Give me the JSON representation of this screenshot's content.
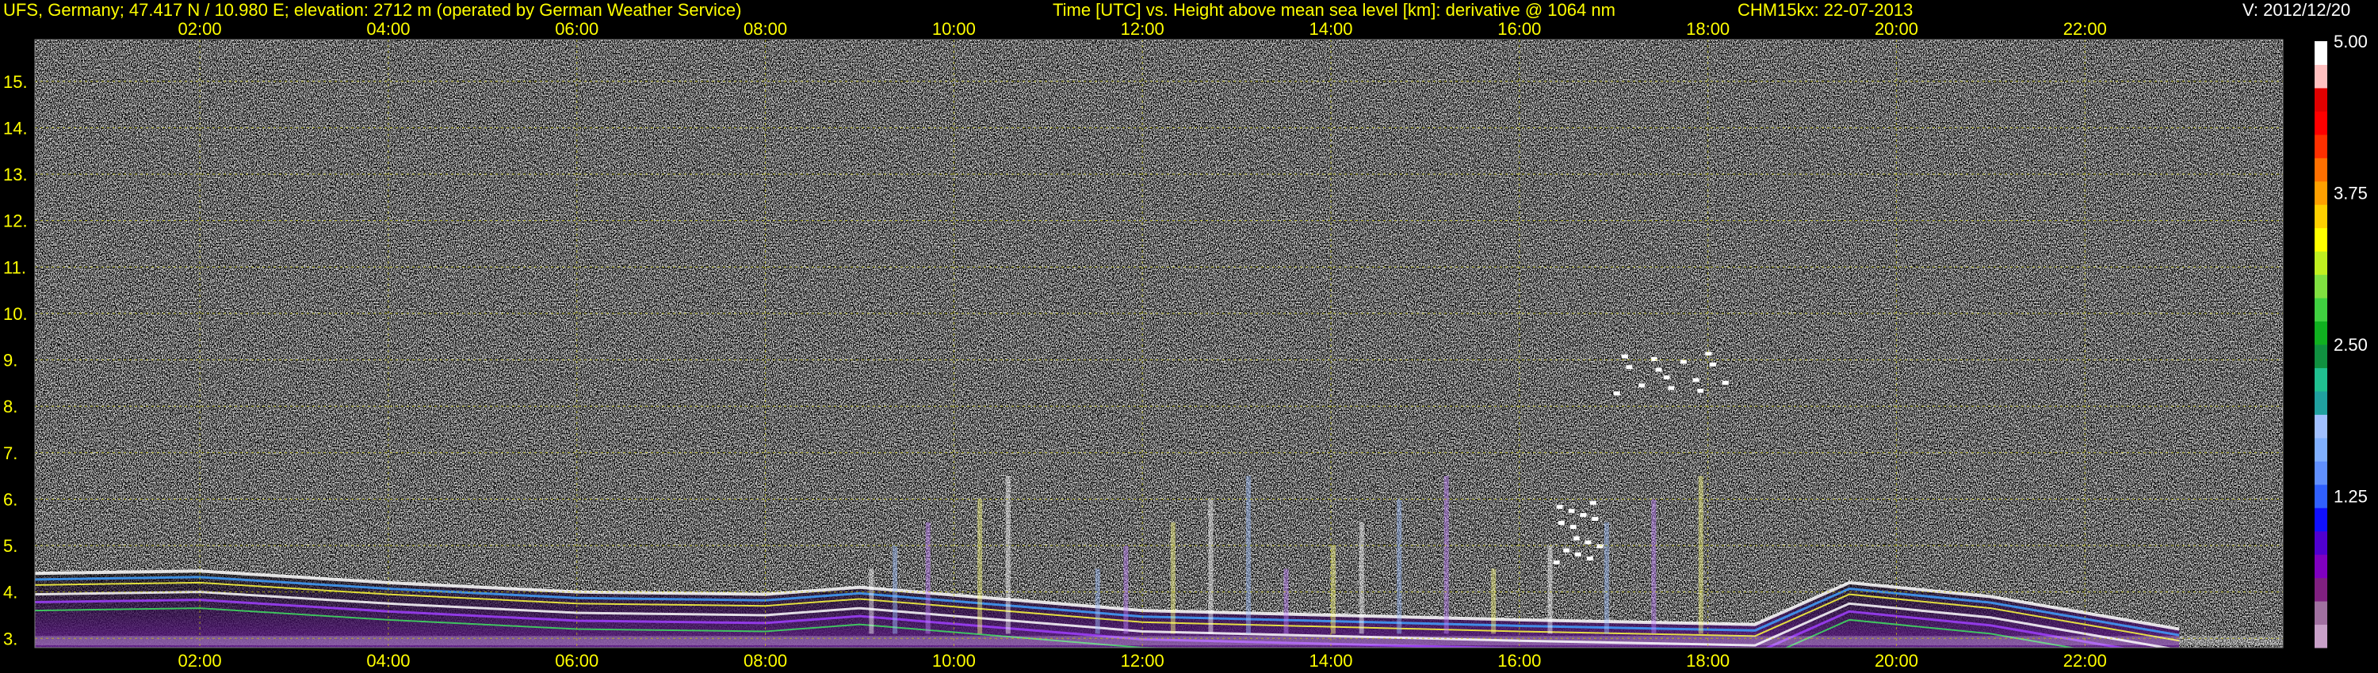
{
  "header": {
    "site": "UFS, Germany; 47.417 N / 10.980 E; elevation: 2712 m  (operated by German Weather Service)",
    "axis_description": "Time [UTC] vs. Height above mean sea level [km]: derivative @ 1064 nm",
    "instrument_date": "CHM15kx: 22-07-2013",
    "version": "V: 2012/12/20"
  },
  "colors": {
    "text": "#ffff00",
    "grid": "#c8c800",
    "background": "#000000",
    "colorbar": [
      "#c8a0c8",
      "#a070a0",
      "#802080",
      "#8000c0",
      "#5000d0",
      "#1010ff",
      "#3060ff",
      "#6090ff",
      "#80b0ff",
      "#a0c0ff",
      "#20a0a0",
      "#20c090",
      "#109040",
      "#10b020",
      "#40d040",
      "#80e040",
      "#c0f020",
      "#ffff00",
      "#ffd000",
      "#ffa000",
      "#ff7000",
      "#ff3000",
      "#ff0000",
      "#e00000",
      "#ffc0c0",
      "#ffffff"
    ]
  },
  "chart_data": {
    "type": "heatmap",
    "title": "Time [UTC] vs. Height above mean sea level [km]: derivative @ 1064 nm",
    "xlabel": "Time [UTC]",
    "ylabel": "Height above mean sea level [km]",
    "xlim": [
      0.25,
      24.1
    ],
    "ylim": [
      2.8,
      15.9
    ],
    "x_ticks": [
      {
        "value": 2,
        "label": "02:00"
      },
      {
        "value": 4,
        "label": "04:00"
      },
      {
        "value": 6,
        "label": "06:00"
      },
      {
        "value": 8,
        "label": "08:00"
      },
      {
        "value": 10,
        "label": "10:00"
      },
      {
        "value": 12,
        "label": "12:00"
      },
      {
        "value": 14,
        "label": "14:00"
      },
      {
        "value": 16,
        "label": "16:00"
      },
      {
        "value": 18,
        "label": "18:00"
      },
      {
        "value": 20,
        "label": "20:00"
      },
      {
        "value": 22,
        "label": "22:00"
      }
    ],
    "y_ticks": [
      {
        "value": 3,
        "label": "3."
      },
      {
        "value": 4,
        "label": "4."
      },
      {
        "value": 5,
        "label": "5."
      },
      {
        "value": 6,
        "label": "6."
      },
      {
        "value": 7,
        "label": "7."
      },
      {
        "value": 8,
        "label": "8."
      },
      {
        "value": 9,
        "label": "9."
      },
      {
        "value": 10,
        "label": "10."
      },
      {
        "value": 11,
        "label": "11."
      },
      {
        "value": 12,
        "label": "12."
      },
      {
        "value": 13,
        "label": "13."
      },
      {
        "value": 14,
        "label": "14."
      },
      {
        "value": 15,
        "label": "15."
      }
    ],
    "grid": true,
    "colorbar": {
      "min": 0,
      "max": 5.0,
      "ticks": [
        {
          "value": 1.25,
          "label": "1.25"
        },
        {
          "value": 2.5,
          "label": "2.50"
        },
        {
          "value": 3.75,
          "label": "3.75"
        },
        {
          "value": 5.0,
          "label": "5.00"
        }
      ]
    },
    "features": {
      "aerosol_layer_top_km": [
        {
          "x": 0.25,
          "y": 4.4
        },
        {
          "x": 2,
          "y": 4.45
        },
        {
          "x": 4,
          "y": 4.2
        },
        {
          "x": 6,
          "y": 4.0
        },
        {
          "x": 8,
          "y": 3.95
        },
        {
          "x": 9,
          "y": 4.1
        },
        {
          "x": 12,
          "y": 3.6
        },
        {
          "x": 16,
          "y": 3.4
        },
        {
          "x": 18.5,
          "y": 3.3
        },
        {
          "x": 19.5,
          "y": 4.2
        },
        {
          "x": 21,
          "y": 3.9
        },
        {
          "x": 23,
          "y": 3.2
        }
      ],
      "cloud_patches": [
        {
          "x": 17.6,
          "y": 8.8
        },
        {
          "x": 16.6,
          "y": 5.4
        }
      ]
    }
  }
}
